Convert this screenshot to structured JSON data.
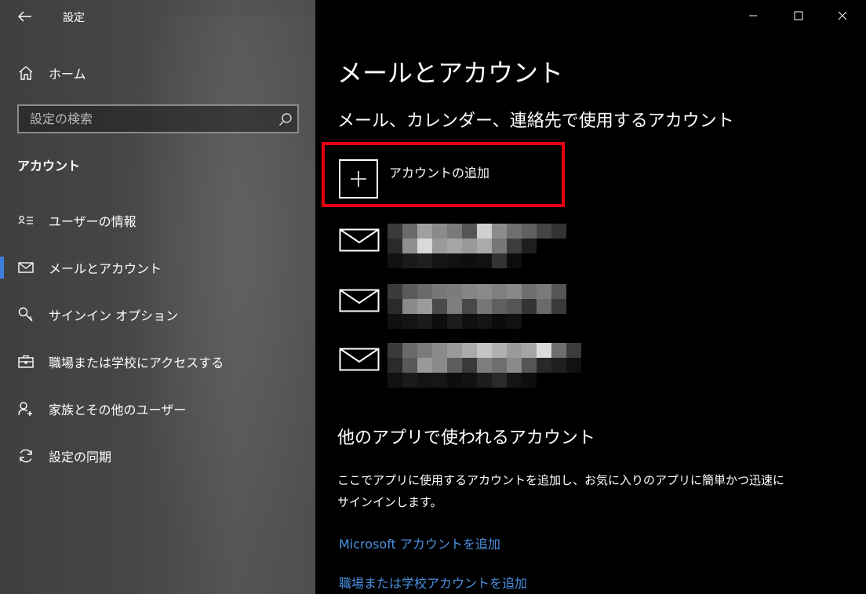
{
  "window": {
    "title": "設定"
  },
  "sidebar": {
    "home_label": "ホーム",
    "search_placeholder": "設定の検索",
    "section_label": "アカウント",
    "items": [
      {
        "label": "ユーザーの情報",
        "icon": "user-info-icon"
      },
      {
        "label": "メールとアカウント",
        "icon": "mail-icon",
        "active": true
      },
      {
        "label": "サインイン オプション",
        "icon": "key-icon"
      },
      {
        "label": "職場または学校にアクセスする",
        "icon": "briefcase-icon"
      },
      {
        "label": "家族とその他のユーザー",
        "icon": "add-person-icon"
      },
      {
        "label": "設定の同期",
        "icon": "sync-icon"
      }
    ]
  },
  "main": {
    "page_title": "メールとアカウント",
    "subtitle": "メール、カレンダー、連絡先で使用するアカウント",
    "add_account_label": "アカウントの追加",
    "other_apps_title": "他のアプリで使われるアカウント",
    "other_apps_description": "ここでアプリに使用するアカウントを追加し、お気に入りのアプリに簡単かつ迅速にサインインします。",
    "links": [
      "Microsoft アカウントを追加",
      "職場または学校アカウントを追加"
    ]
  },
  "colors": {
    "highlight": "#e60012",
    "accent": "#3f7fe0",
    "link": "#4a90e2"
  }
}
